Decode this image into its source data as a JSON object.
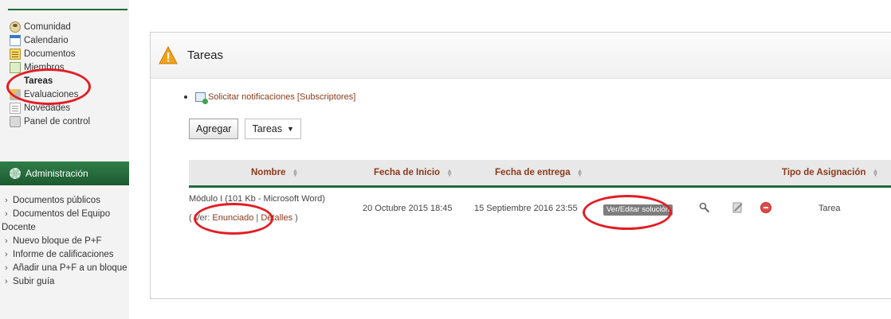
{
  "sidebar": {
    "items": [
      {
        "label": "Comunidad",
        "icon": "community-icon"
      },
      {
        "label": "Calendario",
        "icon": "calendar-icon"
      },
      {
        "label": "Documentos",
        "icon": "documents-icon"
      },
      {
        "label": "Miembros",
        "icon": "members-icon"
      },
      {
        "label": "Tareas",
        "icon": "tasks-icon"
      },
      {
        "label": "Evaluaciones",
        "icon": "evaluations-icon"
      },
      {
        "label": "Novedades",
        "icon": "news-icon"
      },
      {
        "label": "Panel de control",
        "icon": "control-panel-icon"
      }
    ],
    "admin_title": "Administración",
    "admin_items": [
      "Documentos públicos",
      "Documentos del Equipo",
      "Nuevo bloque de P+F",
      "Informe de calificaciones",
      "Añadir una P+F a un bloque",
      "Subir guía"
    ],
    "admin_items_wrap": "Docente"
  },
  "panel": {
    "title": "Tareas",
    "subscribe": {
      "link": "Solicitar notificaciones",
      "subscribers": "[Subscriptores]"
    },
    "add_button": "Agregar",
    "select_value": "Tareas",
    "table": {
      "columns": [
        "Nombre",
        "Fecha de Inicio",
        "Fecha de entrega",
        "Tipo de Asignación"
      ],
      "row": {
        "name": "Módulo I (101 Kb - Microsoft Word)",
        "links_prefix": "( ",
        "links_ver": "Ver:",
        "links_enunciado": "Enunciado",
        "links_sep": " | ",
        "links_detalles": "Detalles",
        "links_suffix": " )",
        "start": "20 Octubre 2015 18:45",
        "due": "15 Septiembre 2016 23:55",
        "action": "Ver/Editar solución",
        "type": "Tarea"
      }
    }
  },
  "colors": {
    "accent_green": "#1f6a3a",
    "link": "#8b3a1a",
    "annotation_red": "#e31d24"
  }
}
